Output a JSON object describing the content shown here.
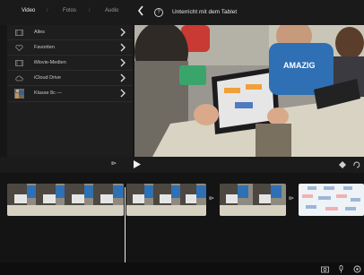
{
  "topbar": {
    "segments": [
      "Video",
      "Fotos",
      "Audio"
    ],
    "active_segment": "Video",
    "separator": "/",
    "help_glyph": "?",
    "project_title": "Unterricht mit dem Tablet"
  },
  "library": {
    "items": [
      {
        "label": "Alles",
        "icon": "film-icon"
      },
      {
        "label": "Favoriten",
        "icon": "heart-icon"
      },
      {
        "label": "iMovie-Medien",
        "icon": "film-icon"
      },
      {
        "label": "iCloud Drive",
        "icon": "cloud-icon"
      },
      {
        "label": "Klasse 8c —",
        "icon": "thumbnail-icon"
      }
    ]
  },
  "timeline": {
    "skip_glyph": "⧐",
    "transition_glyph": "⧐"
  },
  "colors": {
    "accent": "#f2f2f2",
    "background": "#161616",
    "panel": "#1e1e1e"
  }
}
